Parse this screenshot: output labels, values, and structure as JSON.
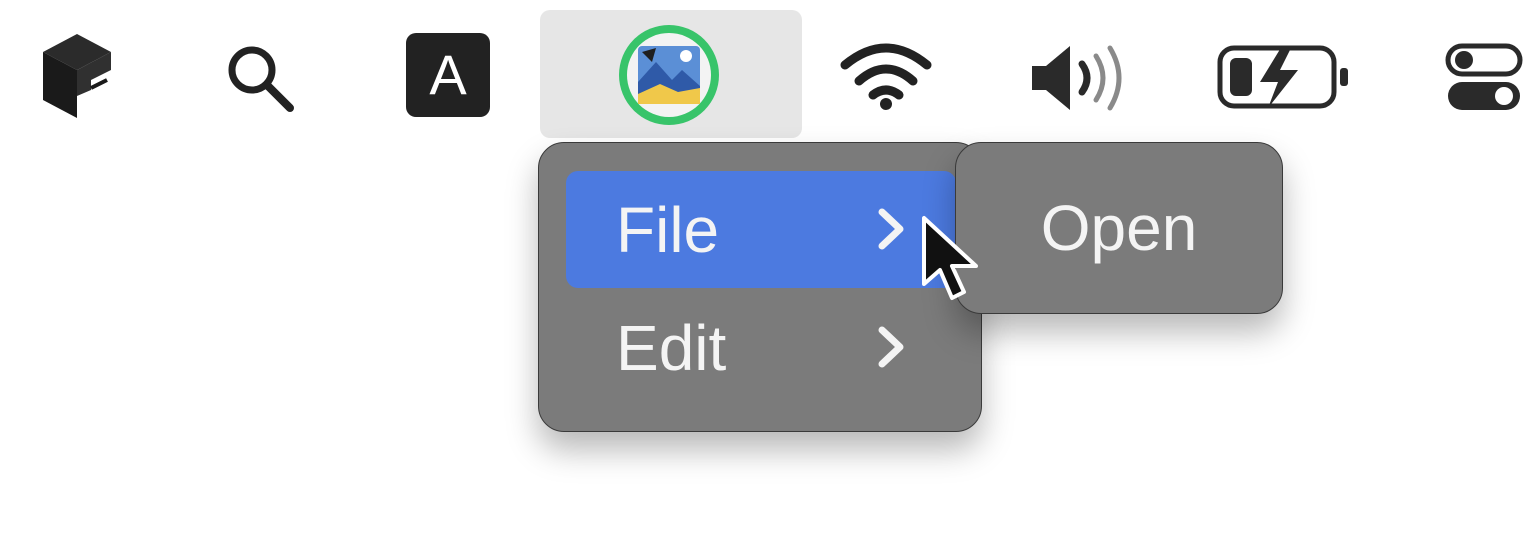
{
  "menubar": {
    "items": [
      {
        "name": "app-cube-icon"
      },
      {
        "name": "search-icon"
      },
      {
        "name": "keyboard-input-icon",
        "letter": "A"
      },
      {
        "name": "photo-app-icon",
        "active": true
      },
      {
        "name": "wifi-icon"
      },
      {
        "name": "volume-icon"
      },
      {
        "name": "battery-charging-icon"
      },
      {
        "name": "control-center-icon"
      }
    ]
  },
  "menu": {
    "items": [
      {
        "label": "File",
        "selected": true,
        "has_submenu": true
      },
      {
        "label": "Edit",
        "selected": false,
        "has_submenu": true
      }
    ]
  },
  "submenu": {
    "items": [
      {
        "label": "Open"
      }
    ]
  },
  "colors": {
    "menu_bg": "#7b7b7b",
    "highlight": "#4c7ae0",
    "menu_text": "#f4f4f4",
    "icon": "#222222"
  }
}
